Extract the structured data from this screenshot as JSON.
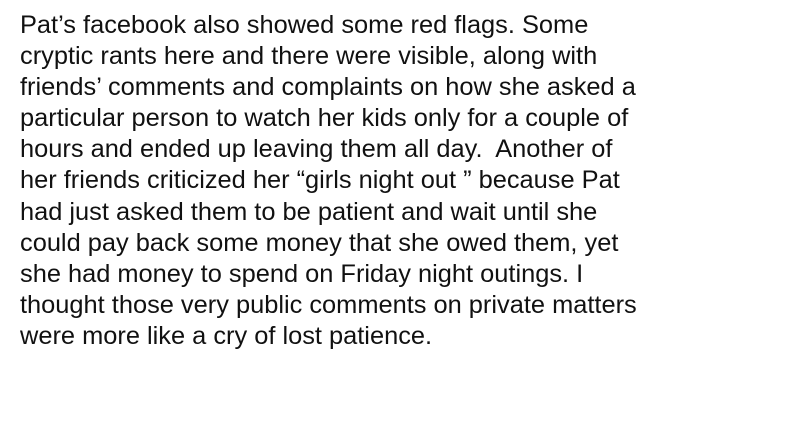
{
  "document": {
    "lines": [
      "Pat’s facebook also showed some red flags. Some",
      "cryptic rants here and there were visible, along with",
      "friends’ comments and complaints on how she asked a",
      "particular person to watch her kids only for a couple of",
      "hours and ended up leaving them all day.  Another of",
      "her friends criticized her “girls night out ” because Pat",
      "had just asked them to be patient and wait until she",
      "could pay back some money that she owed them, yet",
      "she had money to spend on Friday night outings. I",
      "thought those very public comments on private matters",
      "were more like a cry of lost patience."
    ]
  }
}
